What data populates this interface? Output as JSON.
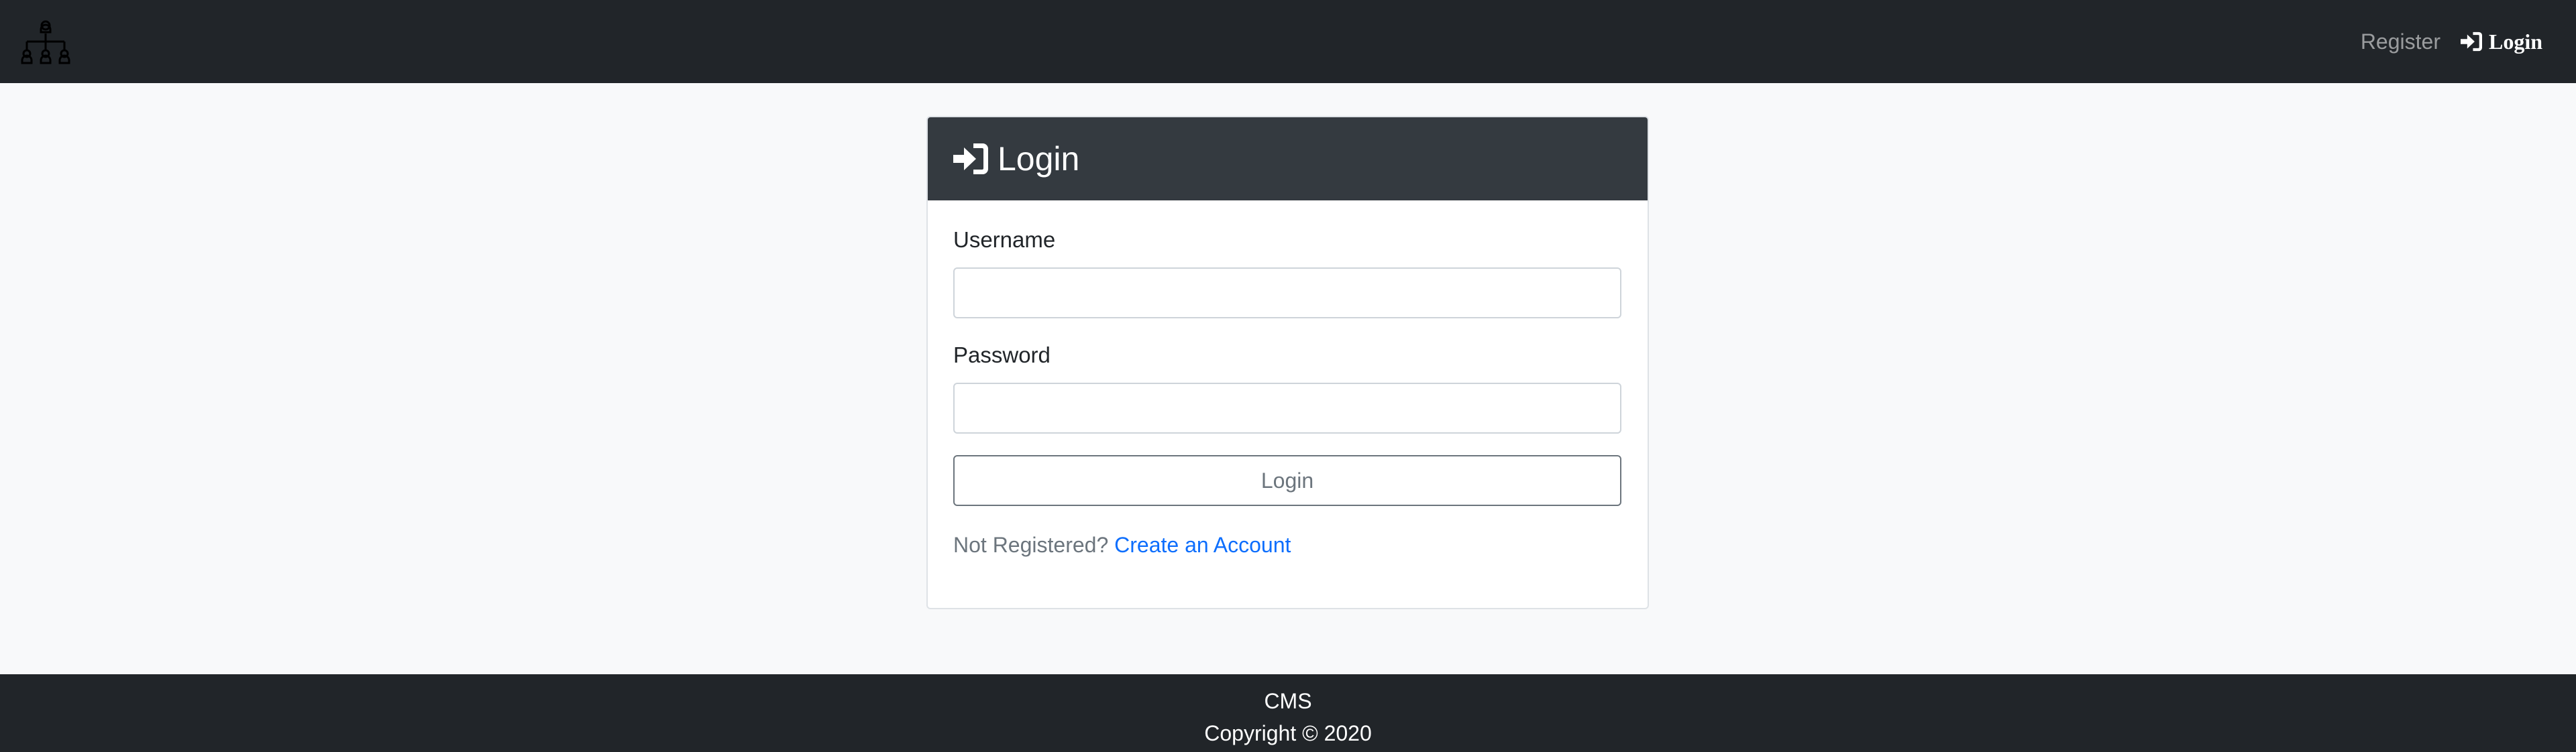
{
  "navbar": {
    "logo_icon": "org-chart-icon",
    "register_label": "Register",
    "login_label": "Login",
    "login_icon": "sign-in-icon"
  },
  "card": {
    "header_icon": "sign-in-icon",
    "title": "Login",
    "username_label": "Username",
    "username_value": "",
    "password_label": "Password",
    "password_value": "",
    "submit_label": "Login",
    "not_registered_text": "Not Registered?",
    "create_account_label": "Create an Account"
  },
  "footer": {
    "line1": "CMS",
    "line2": "Copyright © 2020"
  },
  "colors": {
    "navbar_bg": "#212529",
    "card_header_bg": "#343a40",
    "page_bg": "#f8f9fa",
    "link": "#0d6efd",
    "muted": "#6c757d"
  }
}
